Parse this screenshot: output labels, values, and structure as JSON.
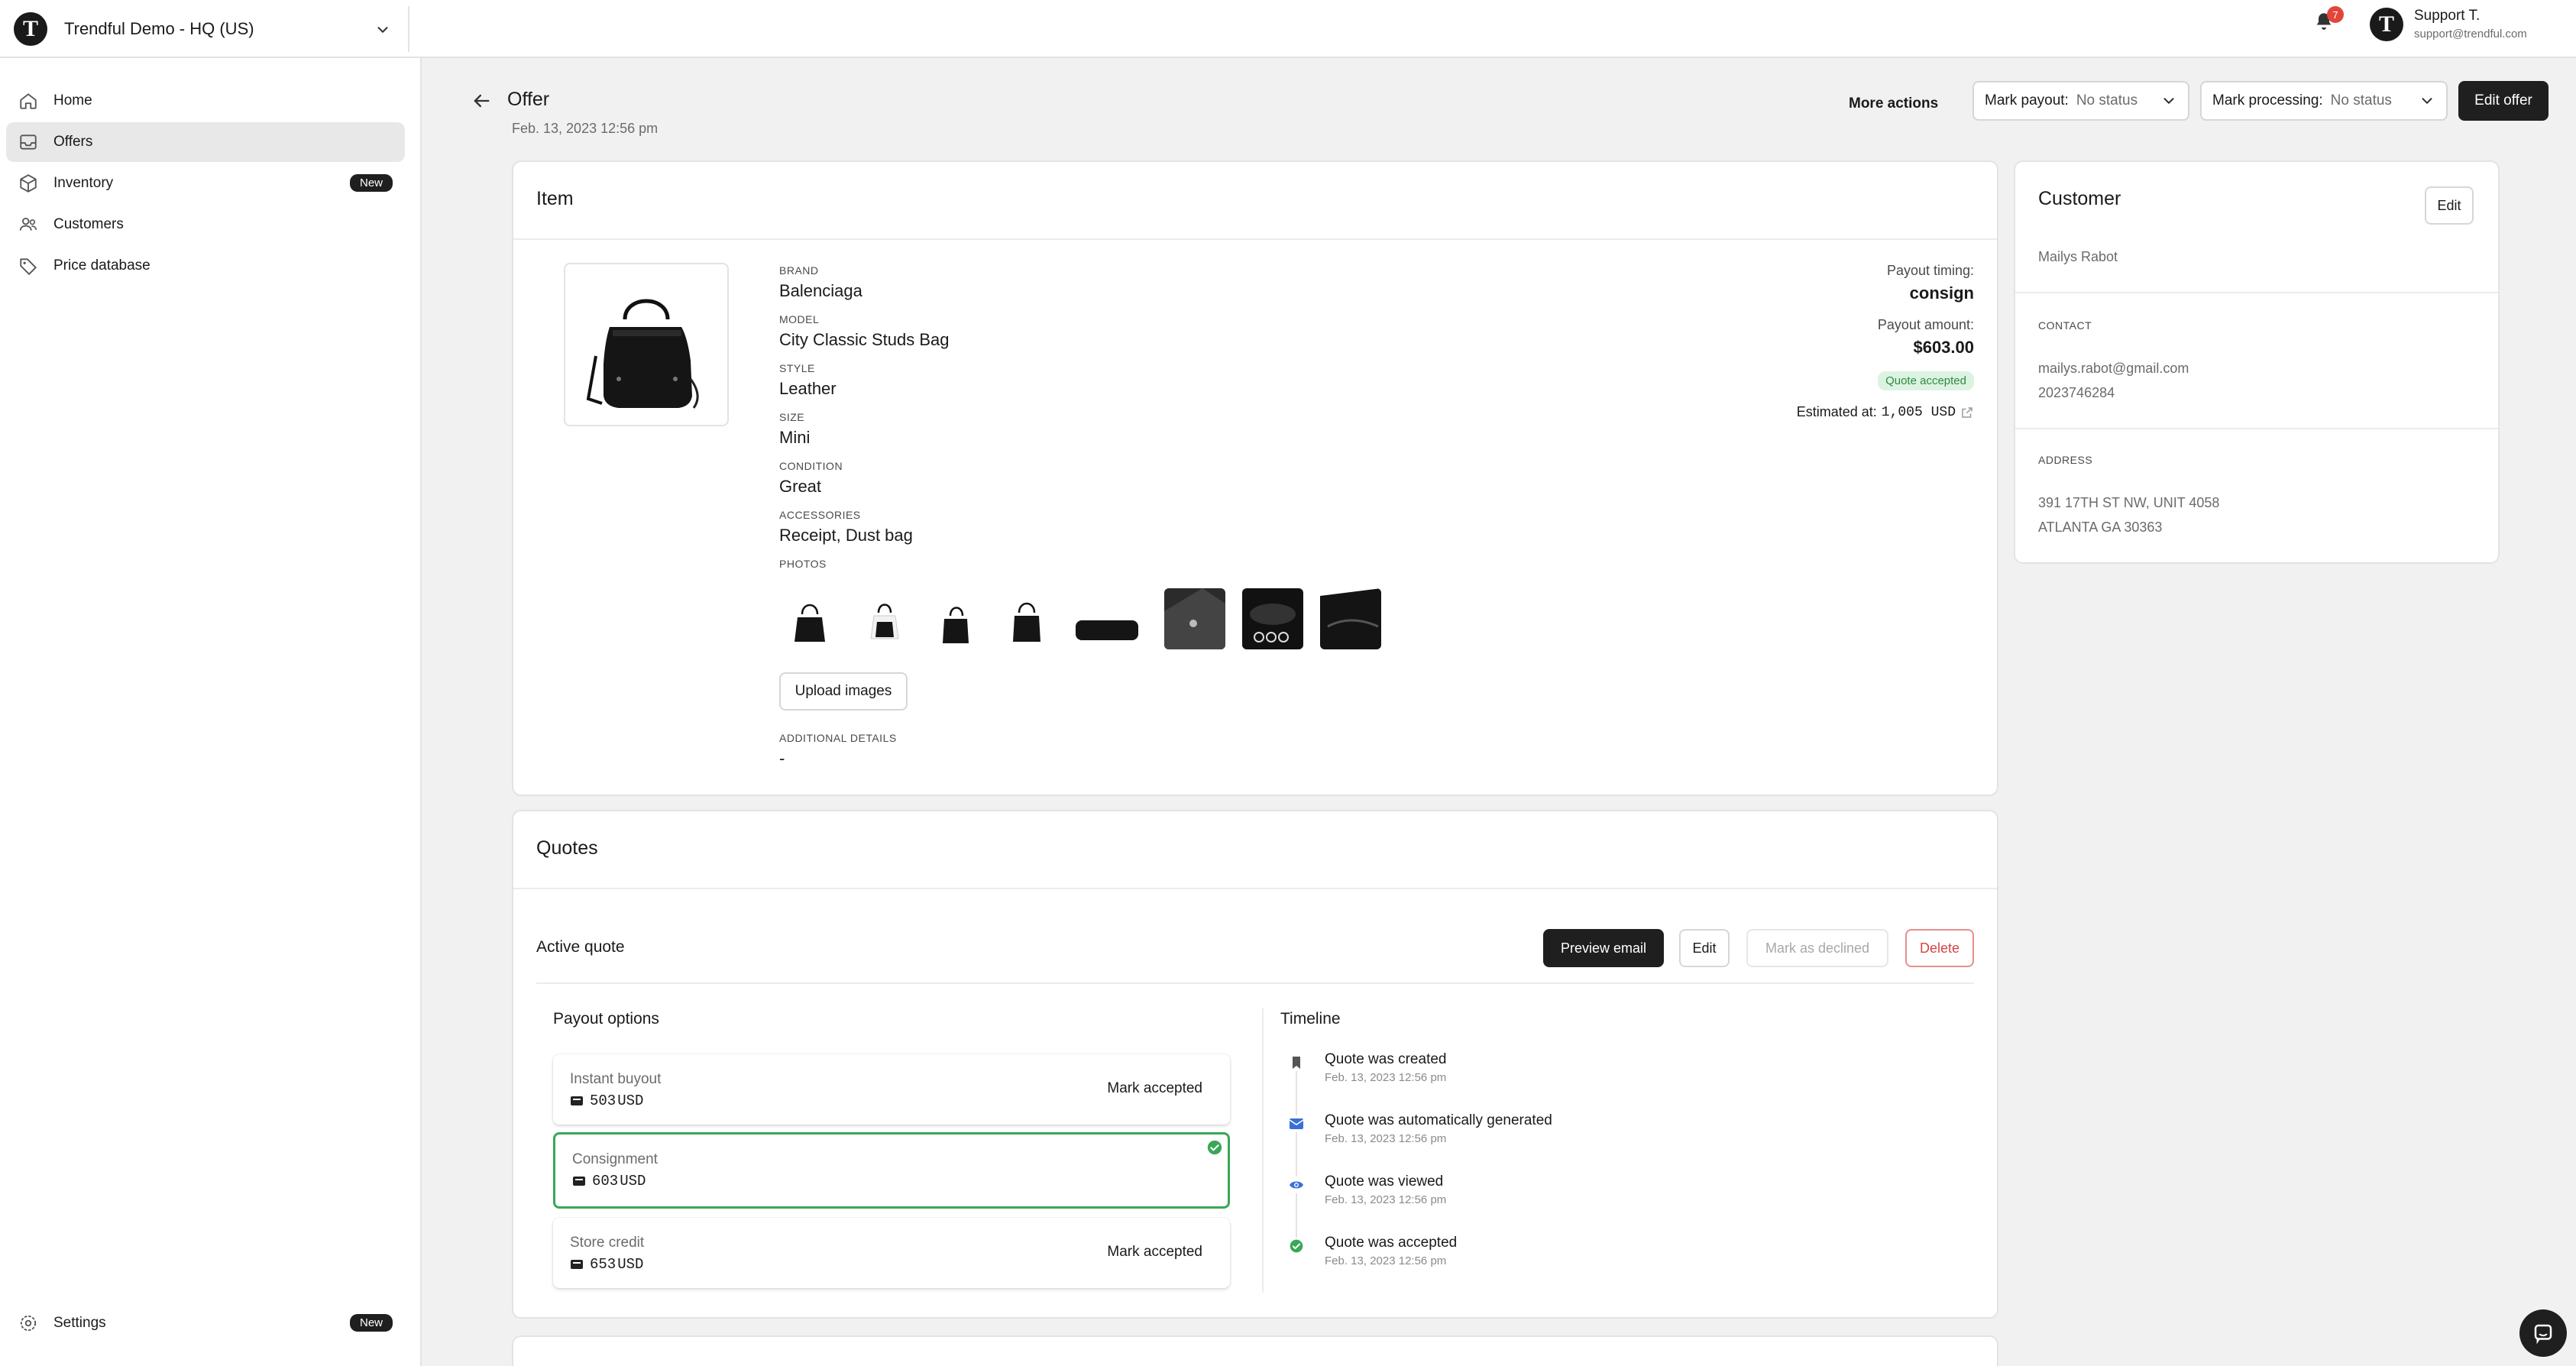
{
  "store": {
    "logo_letter": "T",
    "name": "Trendful Demo - HQ (US)"
  },
  "nav": {
    "items": [
      {
        "label": "Home",
        "icon": "home-icon"
      },
      {
        "label": "Offers",
        "icon": "inbox-icon",
        "active": true
      },
      {
        "label": "Inventory",
        "icon": "box-icon",
        "badge": "New"
      },
      {
        "label": "Customers",
        "icon": "people-icon"
      },
      {
        "label": "Price database",
        "icon": "tag-icon"
      }
    ],
    "settings": {
      "label": "Settings",
      "icon": "gear-icon",
      "badge": "New"
    }
  },
  "topbar": {
    "notification_count": "7",
    "user": {
      "avatar_letter": "T",
      "name": "Support T.",
      "email": "support@trendful.com"
    }
  },
  "page": {
    "title": "Offer",
    "date": "Feb. 13, 2023 12:56 pm",
    "more_actions": "More actions",
    "mark_payout": {
      "label": "Mark payout:",
      "value": "No status"
    },
    "mark_processing": {
      "label": "Mark processing:",
      "value": "No status"
    },
    "edit_offer": "Edit offer"
  },
  "item": {
    "title": "Item",
    "fields": [
      {
        "label": "BRAND",
        "value": "Balenciaga"
      },
      {
        "label": "MODEL",
        "value": "City Classic Studs Bag"
      },
      {
        "label": "STYLE",
        "value": "Leather"
      },
      {
        "label": "SIZE",
        "value": "Mini"
      },
      {
        "label": "CONDITION",
        "value": "Great"
      },
      {
        "label": "ACCESSORIES",
        "value": "Receipt, Dust bag"
      }
    ],
    "photos_label": "PHOTOS",
    "upload_label": "Upload images",
    "additional_label": "ADDITIONAL DETAILS",
    "additional_value": "-",
    "payout_timing_label": "Payout timing:",
    "payout_timing_value": "consign",
    "payout_amount_label": "Payout amount:",
    "payout_amount_value": "$603.00",
    "status_badge": "Quote accepted",
    "estimated_label": "Estimated at:",
    "estimated_value": "1,005 USD"
  },
  "customer": {
    "title": "Customer",
    "edit_label": "Edit",
    "name": "Mailys Rabot",
    "contact_label": "CONTACT",
    "email": "mailys.rabot@gmail.com",
    "phone": "2023746284",
    "address_label": "ADDRESS",
    "address_line1": "391 17TH ST NW, UNIT 4058",
    "address_line2": "ATLANTA GA 30363"
  },
  "quotes": {
    "title": "Quotes",
    "active_quote_label": "Active quote",
    "preview_email": "Preview email",
    "edit": "Edit",
    "mark_declined": "Mark as declined",
    "delete": "Delete",
    "payout_options_title": "Payout options",
    "options": [
      {
        "label": "Instant buyout",
        "value": "503",
        "currency": "USD",
        "action": "Mark accepted"
      },
      {
        "label": "Consignment",
        "value": "603",
        "currency": "USD",
        "selected": true
      },
      {
        "label": "Store credit",
        "value": "653",
        "currency": "USD",
        "action": "Mark accepted"
      }
    ],
    "timeline_title": "Timeline",
    "timeline": [
      {
        "title": "Quote was created",
        "date": "Feb. 13, 2023 12:56 pm",
        "icon": "bookmark-icon"
      },
      {
        "title": "Quote was automatically generated",
        "date": "Feb. 13, 2023 12:56 pm",
        "icon": "mail-icon"
      },
      {
        "title": "Quote was viewed",
        "date": "Feb. 13, 2023 12:56 pm",
        "icon": "eye-icon"
      },
      {
        "title": "Quote was accepted",
        "date": "Feb. 13, 2023 12:56 pm",
        "icon": "check-circle-icon"
      }
    ]
  },
  "colors": {
    "accent_green": "#3aa757",
    "primary_dark": "#1f1f1f",
    "danger": "#d64545",
    "notification_red": "#e2463a",
    "timeline_blue": "#3b6fd8"
  }
}
